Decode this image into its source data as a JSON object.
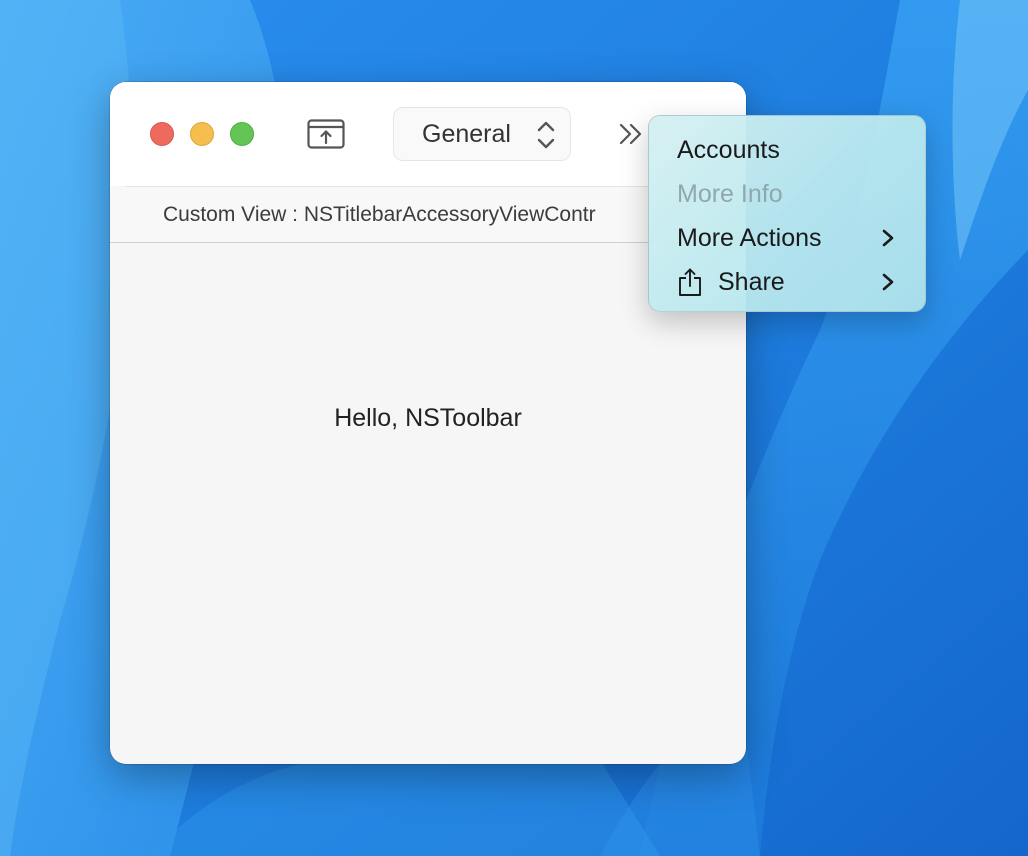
{
  "window": {
    "toolbar": {
      "icon_button": "tray-and-arrow-up-icon",
      "popup": {
        "selected_value": "General"
      },
      "overflow_icon": "chevron-double-right-icon"
    },
    "accessory_label": "Custom View : NSTitlebarAccessoryViewContr",
    "content_text": "Hello, NSToolbar"
  },
  "overflow_menu": {
    "items": [
      {
        "label": "Accounts",
        "enabled": true,
        "has_submenu": false
      },
      {
        "label": "More Info",
        "enabled": false,
        "has_submenu": false
      },
      {
        "label": "More Actions",
        "enabled": true,
        "has_submenu": true
      },
      {
        "label": "Share",
        "enabled": true,
        "has_submenu": true,
        "icon": "share-icon"
      }
    ]
  },
  "colors": {
    "desktop": "#1f7fe0",
    "traffic_close": "#ee6a5f",
    "traffic_minimize": "#f5be4f",
    "traffic_zoom": "#62c554",
    "menu_background": "#bce8ee",
    "disabled_text": "#8fa8ae"
  }
}
